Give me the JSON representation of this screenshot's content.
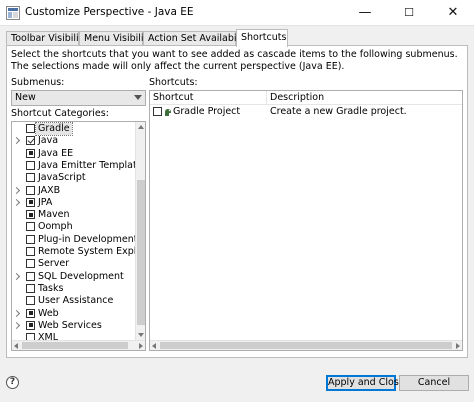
{
  "window": {
    "title": "Customize Perspective - Java EE",
    "minimize": "—",
    "maximize": "☐",
    "close": "✕"
  },
  "tabs": [
    {
      "label": "Toolbar Visibility",
      "active": false
    },
    {
      "label": "Menu Visibility",
      "active": false
    },
    {
      "label": "Action Set Availability",
      "active": false
    },
    {
      "label": "Shortcuts",
      "active": true
    }
  ],
  "shortcuts_page": {
    "description": "Select the shortcuts that you want to see added as cascade items to the following submenus. The selections made will only affect the current perspective (Java EE).",
    "submenus_label": "Submenus:",
    "submenu_selected": "New",
    "categories_label": "Shortcut Categories:",
    "shortcuts_label": "Shortcuts:",
    "categories": [
      {
        "label": "Gradle",
        "expandable": false,
        "state": "empty",
        "selected": true
      },
      {
        "label": "Java",
        "expandable": true,
        "state": "checked",
        "selected": false
      },
      {
        "label": "Java EE",
        "expandable": false,
        "state": "filled",
        "selected": false
      },
      {
        "label": "Java Emitter Templates",
        "expandable": false,
        "state": "empty",
        "selected": false
      },
      {
        "label": "JavaScript",
        "expandable": false,
        "state": "empty",
        "selected": false
      },
      {
        "label": "JAXB",
        "expandable": true,
        "state": "empty",
        "selected": false
      },
      {
        "label": "JPA",
        "expandable": true,
        "state": "filled",
        "selected": false
      },
      {
        "label": "Maven",
        "expandable": false,
        "state": "filled",
        "selected": false
      },
      {
        "label": "Oomph",
        "expandable": false,
        "state": "empty",
        "selected": false
      },
      {
        "label": "Plug-in Development",
        "expandable": false,
        "state": "empty",
        "selected": false
      },
      {
        "label": "Remote System Explorer",
        "expandable": false,
        "state": "empty",
        "selected": false
      },
      {
        "label": "Server",
        "expandable": false,
        "state": "empty",
        "selected": false
      },
      {
        "label": "SQL Development",
        "expandable": true,
        "state": "empty",
        "selected": false
      },
      {
        "label": "Tasks",
        "expandable": false,
        "state": "empty",
        "selected": false
      },
      {
        "label": "User Assistance",
        "expandable": false,
        "state": "empty",
        "selected": false
      },
      {
        "label": "Web",
        "expandable": true,
        "state": "filled",
        "selected": false
      },
      {
        "label": "Web Services",
        "expandable": true,
        "state": "filled",
        "selected": false
      },
      {
        "label": "XML",
        "expandable": false,
        "state": "empty",
        "selected": false
      }
    ],
    "columns": {
      "shortcut": "Shortcut",
      "description": "Description"
    },
    "shortcut_rows": [
      {
        "name": "Gradle Project",
        "description": "Create a new Gradle project.",
        "checked": false
      }
    ]
  },
  "footer": {
    "help": "?",
    "apply_label": "Apply and Close",
    "cancel_label": "Cancel"
  },
  "colors": {
    "accent": "#0078d7",
    "gradle_icon": "#3b6e3b"
  }
}
